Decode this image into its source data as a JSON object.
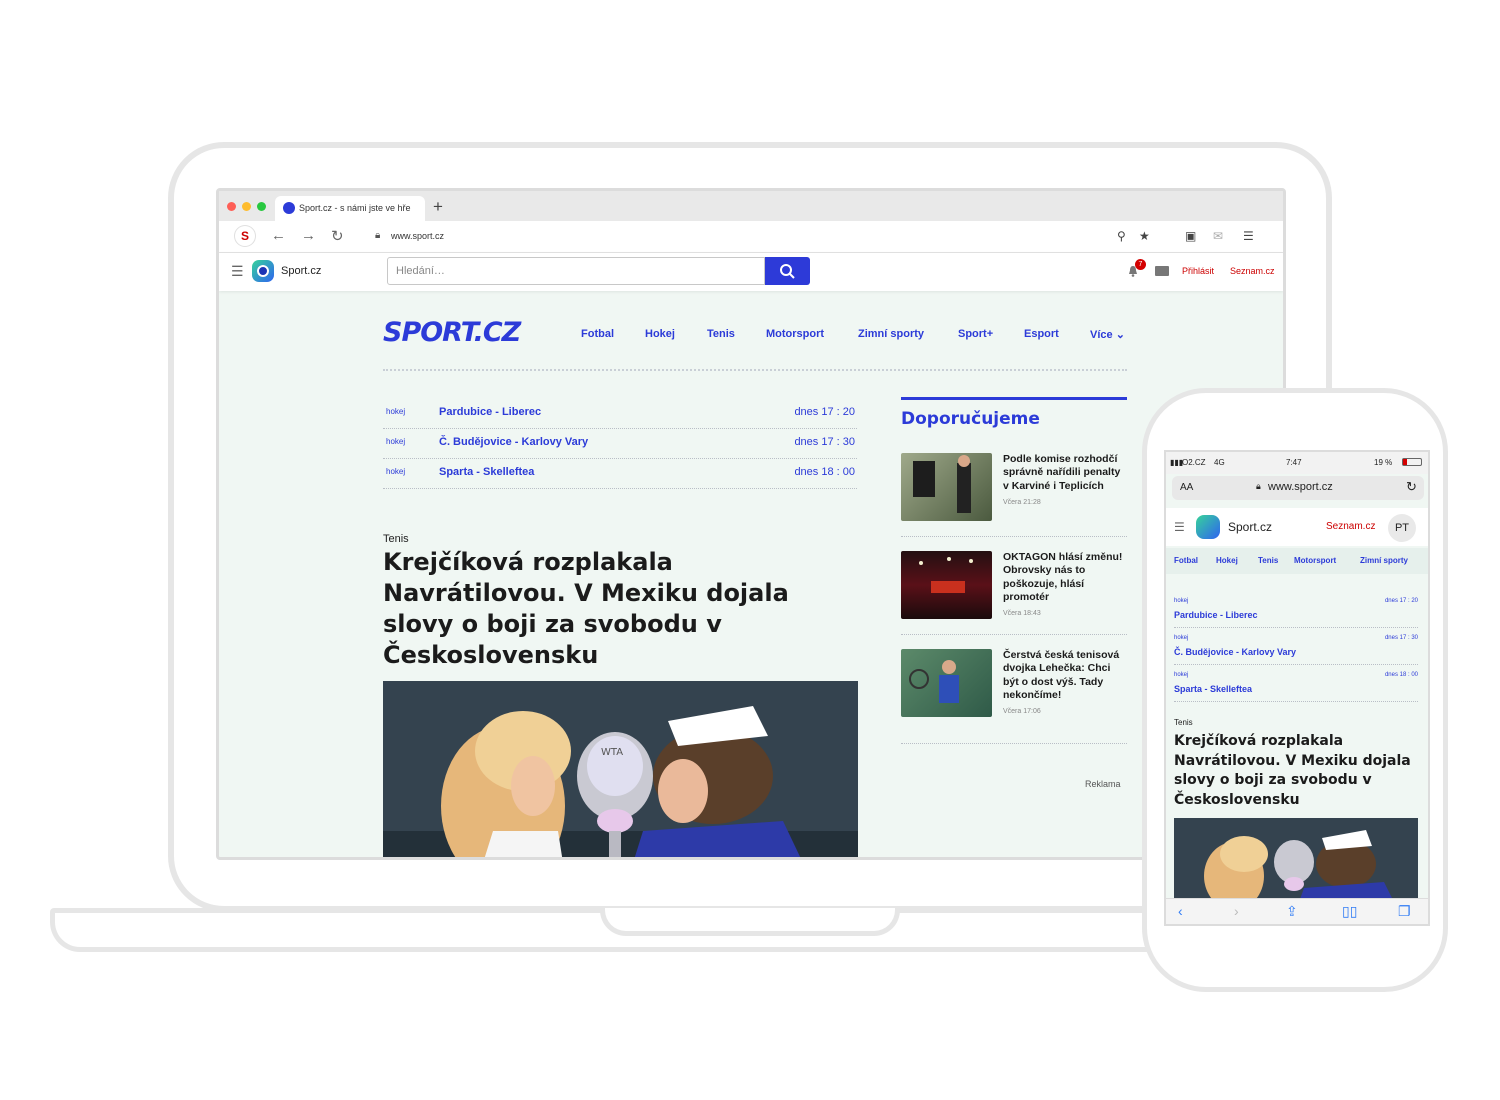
{
  "browser": {
    "tab_title": "Sport.cz - s námi jste ve hře",
    "new_tab": "+",
    "url": "www.sport.cz",
    "seznam_btn": "S"
  },
  "seznam_header": {
    "brand": "Sport.cz",
    "search_placeholder": "Hledání…",
    "notification_count": "7",
    "login": "Přihlásit",
    "seznam": "Seznam.cz"
  },
  "site": {
    "logo": "SPORT.CZ",
    "nav": [
      "Fotbal",
      "Hokej",
      "Tenis",
      "Motorsport",
      "Zimní sporty",
      "Sport+",
      "Esport",
      "Více"
    ]
  },
  "matches": [
    {
      "sport": "hokej",
      "teams": "Pardubice - Liberec",
      "time": "dnes 17 : 20"
    },
    {
      "sport": "hokej",
      "teams": "Č. Budějovice - Karlovy Vary",
      "time": "dnes 17 : 30"
    },
    {
      "sport": "hokej",
      "teams": "Sparta - Skelleftea",
      "time": "dnes 18 : 00"
    }
  ],
  "article": {
    "category": "Tenis",
    "title": "Krejčíková rozplakala Navrátilovou. V Mexiku dojala slovy o boji za svobodu v Československu",
    "image_caption_logo": "WTA"
  },
  "recommend": {
    "title": "Doporučujeme",
    "items": [
      {
        "text": "Podle komise rozhodčí správně nařídili penalty v Karviné i Teplicích",
        "time": "Včera 21:28"
      },
      {
        "text": "OKTAGON hlásí změnu! Obrovsky nás to poškozuje, hlásí promotér",
        "time": "Včera 18:43"
      },
      {
        "text": "Čerstvá česká tenisová dvojka Lehečka: Chci být o dost výš. Tady nekončíme!",
        "time": "Včera 17:06"
      }
    ],
    "ad": "Reklama"
  },
  "phone": {
    "carrier": "O2.CZ",
    "network": "4G",
    "clock": "7:47",
    "battery": "19 %",
    "text_size": "AA",
    "url": "www.sport.cz",
    "brand": "Sport.cz",
    "seznam": "Seznam.cz",
    "avatar": "PT",
    "nav": [
      "Fotbal",
      "Hokej",
      "Tenis",
      "Motorsport",
      "Zimní sporty"
    ],
    "matches": [
      {
        "sport": "hokej",
        "teams": "Pardubice - Liberec",
        "time": "dnes 17 : 20"
      },
      {
        "sport": "hokej",
        "teams": "Č. Budějovice - Karlovy Vary",
        "time": "dnes 17 : 30"
      },
      {
        "sport": "hokej",
        "teams": "Sparta - Skelleftea",
        "time": "dnes 18 : 00"
      }
    ],
    "category": "Tenis",
    "title": "Krejčíková rozplakala Navrátilovou. V Mexiku dojala slovy o boji za svobodu v Československu"
  }
}
